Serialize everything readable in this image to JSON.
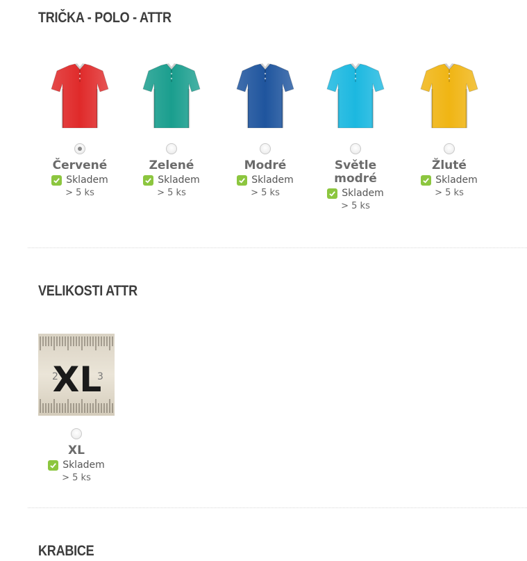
{
  "sections": [
    {
      "title": "TRIČKA - POLO - ATTR",
      "options": [
        {
          "name": "Červené",
          "color": "#e02a2a",
          "selected": true,
          "stock": "Skladem",
          "qty": "> 5 ks"
        },
        {
          "name": "Zelené",
          "color": "#1a9e8e",
          "selected": false,
          "stock": "Skladem",
          "qty": "> 5 ks"
        },
        {
          "name": "Modré",
          "color": "#1f559e",
          "selected": false,
          "stock": "Skladem",
          "qty": "> 5 ks"
        },
        {
          "name": "Světle modré",
          "color": "#1cb8e0",
          "selected": false,
          "stock": "Skladem",
          "qty": "> 5 ks"
        },
        {
          "name": "Žluté",
          "color": "#f0b514",
          "selected": false,
          "stock": "Skladem",
          "qty": "> 5 ks"
        }
      ]
    },
    {
      "title": "VELIKOSTI ATTR",
      "options": [
        {
          "name": "XL",
          "tile_text": "XL",
          "tile_left": "2",
          "tile_right": "3",
          "selected": false,
          "stock": "Skladem",
          "qty": "> 5 ks"
        }
      ]
    },
    {
      "title": "KRABICE",
      "options": []
    }
  ],
  "colors": {
    "check_green": "#8cc63f",
    "title": "#3d3d3d",
    "option_name": "#6b6b6b"
  },
  "icons": {
    "shirt": "polo-shirt-icon",
    "check": "check-icon",
    "ruler": "ruler-icon"
  }
}
